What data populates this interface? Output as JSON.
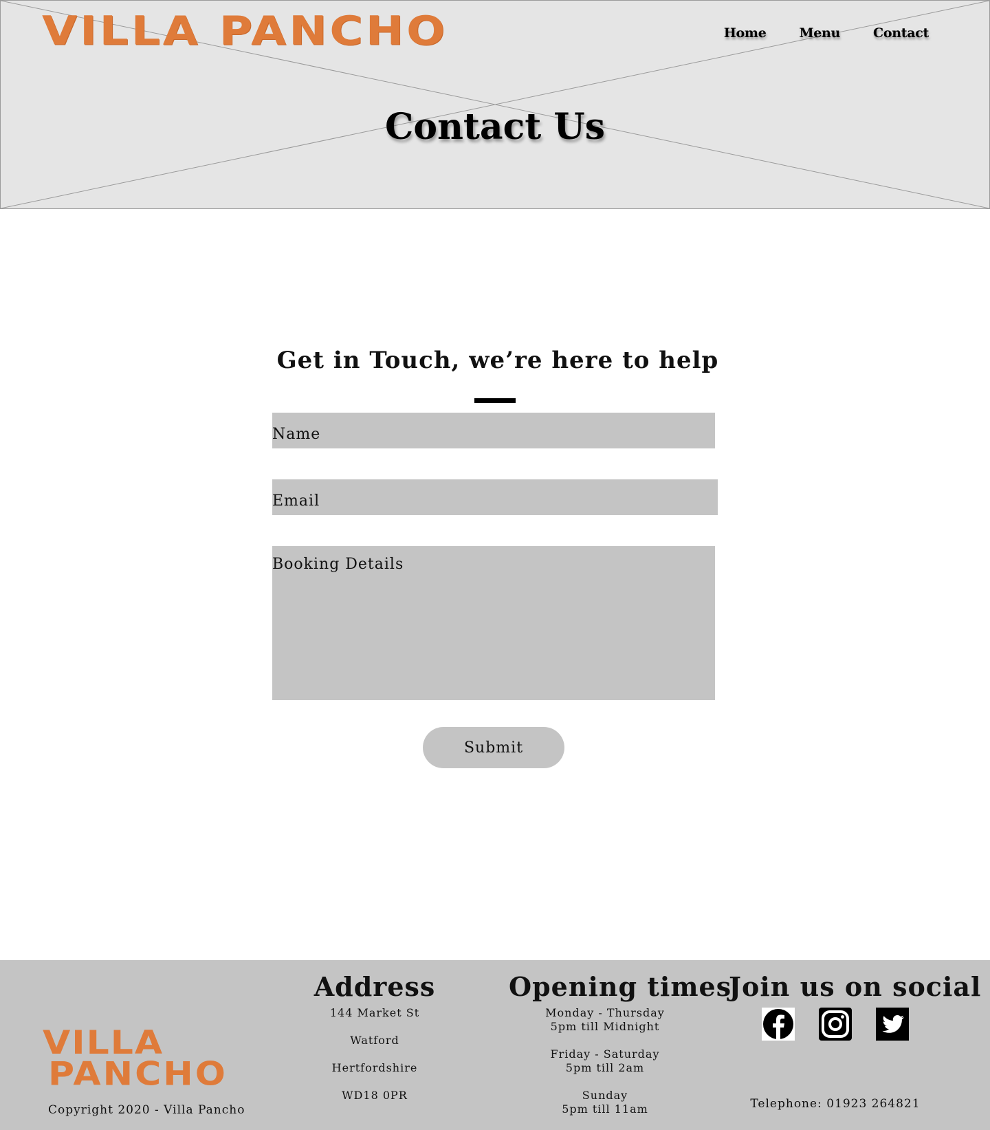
{
  "header": {
    "logo_text": "VILLA PANCHO",
    "nav": [
      "Home",
      "Menu",
      "Contact"
    ],
    "hero_title": "Contact Us"
  },
  "form": {
    "heading": "Get in Touch, we’re here to help",
    "name_placeholder": "Name",
    "email_placeholder": "Email",
    "details_placeholder": "Booking Details",
    "submit_label": "Submit"
  },
  "footer": {
    "logo_line1": "VILLA",
    "logo_line2": "PANCHO",
    "copyright": "Copyright 2020 - Villa Pancho",
    "address": {
      "title": "Address",
      "lines": [
        "144 Market St",
        "Watford",
        "Hertfordshire",
        "WD18 0PR"
      ]
    },
    "opening": {
      "title": "Opening times",
      "groups": [
        {
          "days": "Monday - Thursday",
          "hours": "5pm till Midnight"
        },
        {
          "days": "Friday - Saturday",
          "hours": "5pm till 2am"
        },
        {
          "days": "Sunday",
          "hours": "5pm till 11am"
        }
      ]
    },
    "social": {
      "title": "Join us on social",
      "icons": [
        "facebook-icon",
        "instagram-icon",
        "twitter-icon"
      ],
      "telephone": "Telephone: 01923 264821"
    }
  },
  "colors": {
    "brand_orange": "#df7b3a",
    "hero_bg": "#e5e5e5",
    "field_bg": "#c4c4c4",
    "footer_bg": "#c4c4c4"
  }
}
